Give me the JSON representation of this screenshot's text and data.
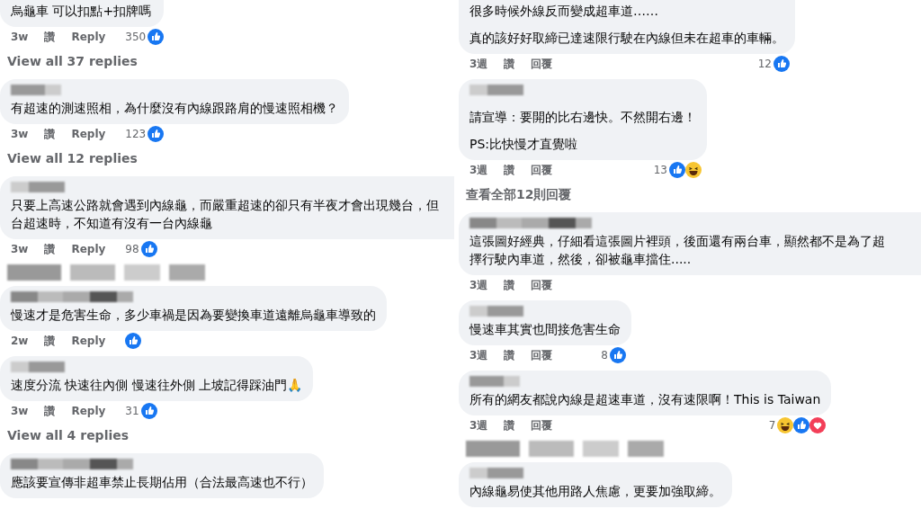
{
  "columns": [
    {
      "items": [
        {
          "kind": "comment",
          "lines": [
            "烏龜車 可以扣點+扣牌嗎"
          ],
          "meta": {
            "time": "3w",
            "like": "讚",
            "reply": "Reply",
            "count": "350",
            "reactions": [
              {
                "kind": "like"
              }
            ]
          }
        },
        {
          "kind": "more",
          "label": "View all 37 replies"
        },
        {
          "kind": "comment",
          "lines": [
            "有超速的測速照相，為什麼沒有內線跟路肩的慢速照相機？"
          ],
          "meta": {
            "time": "3w",
            "like": "讚",
            "reply": "Reply",
            "count": "123",
            "reactions": [
              {
                "kind": "like"
              }
            ]
          }
        },
        {
          "kind": "more",
          "label": "View all 12 replies"
        },
        {
          "kind": "comment",
          "lines": [
            "只要上高速公路就會遇到內線龜，而嚴重超速的卻只有半夜才會出現幾台，但",
            "台超速時，不知道有沒有一台內線龜"
          ],
          "meta": {
            "time": "3w",
            "like": "讚",
            "reply": "Reply",
            "count": "98",
            "reactions": [
              {
                "kind": "like"
              }
            ]
          }
        },
        {
          "kind": "blurred"
        },
        {
          "kind": "comment",
          "lines": [
            "慢速才是危害生命，多少車禍是因為要變換車道遠離烏龜車導致的"
          ],
          "meta": {
            "time": "2w",
            "like": "讚",
            "reply": "Reply",
            "reactions": [
              {
                "kind": "like"
              }
            ]
          }
        },
        {
          "kind": "comment",
          "lines": [
            "速度分流 快速往內側 慢速往外側 上坡記得踩油門🙏"
          ],
          "meta": {
            "time": "3w",
            "like": "讚",
            "reply": "Reply",
            "count": "31",
            "reactions": [
              {
                "kind": "like"
              }
            ]
          }
        },
        {
          "kind": "more",
          "label": "View all 4 replies"
        },
        {
          "kind": "comment",
          "lines": [
            "應該要宣傳非超車禁止長期佔用（合法最高速也不行）"
          ]
        }
      ]
    },
    {
      "items": [
        {
          "kind": "comment",
          "lines": [
            "很多時候外線反而變成超車道……",
            "真的該好好取締已達速限行駛在內線但未在超車的車輛。"
          ],
          "meta": {
            "time": "3週",
            "like": "讚",
            "reply": "回覆",
            "count": "12",
            "reactions": [
              {
                "kind": "like"
              }
            ]
          }
        },
        {
          "kind": "comment",
          "lines": [
            "請宣導：要開的比右邊快。不然開右邊！",
            "PS:比快慢才直覺啦"
          ],
          "meta": {
            "time": "3週",
            "like": "讚",
            "reply": "回覆",
            "count": "13",
            "reactions": [
              {
                "kind": "like"
              },
              {
                "kind": "haha"
              }
            ]
          }
        },
        {
          "kind": "more",
          "label": "查看全部12則回覆"
        },
        {
          "kind": "comment",
          "lines": [
            "這張圖好經典，仔細看這張圖片裡頭，後面還有兩台車，顯然都不是為了超",
            "擇行駛內車道，然後，卻被龜車擋住....."
          ],
          "meta": {
            "time": "3週",
            "like": "讚",
            "reply": "回覆"
          }
        },
        {
          "kind": "comment",
          "lines": [
            "慢速車其實也間接危害生命"
          ],
          "meta": {
            "time": "3週",
            "like": "讚",
            "reply": "回覆",
            "count": "8",
            "reactions": [
              {
                "kind": "like"
              }
            ]
          }
        },
        {
          "kind": "comment",
          "lines": [
            "所有的網友都說內線是超速車道，沒有速限啊！This is Taiwan"
          ],
          "meta": {
            "time": "3週",
            "like": "讚",
            "reply": "回覆",
            "count": "7",
            "reactions": [
              {
                "kind": "haha"
              },
              {
                "kind": "like"
              },
              {
                "kind": "love"
              }
            ]
          }
        },
        {
          "kind": "blurred"
        },
        {
          "kind": "comment",
          "lines": [
            "內線龜易使其他用路人焦慮，更要加強取締。"
          ]
        }
      ]
    }
  ]
}
